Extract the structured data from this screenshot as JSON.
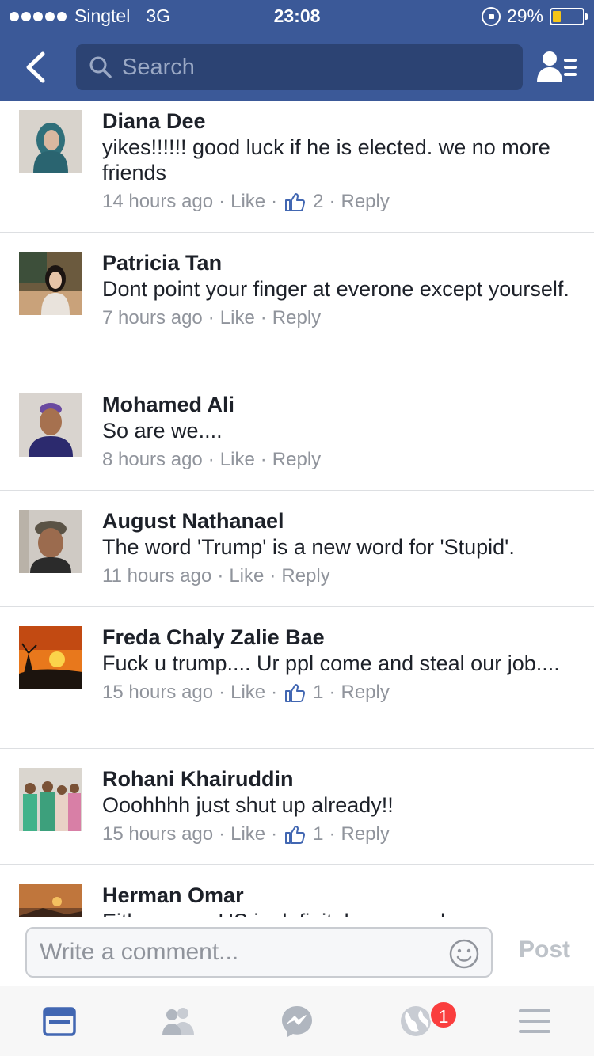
{
  "status_bar": {
    "carrier": "Singtel",
    "network": "3G",
    "time": "23:08",
    "battery": "29%",
    "battery_level": 0.29
  },
  "nav": {
    "search_placeholder": "Search"
  },
  "comments": [
    {
      "name": "Diana Dee",
      "text": "yikes!!!!!! good luck if he is elected. we no more friends",
      "time": "14 hours ago",
      "like": "Like",
      "likes": "2",
      "reply": "Reply"
    },
    {
      "name": "Patricia Tan",
      "text": "Dont point your finger at everone except yourself.",
      "time": "7 hours ago",
      "like": "Like",
      "likes": "",
      "reply": "Reply"
    },
    {
      "name": "Mohamed Ali",
      "text": "So are we....",
      "time": "8 hours ago",
      "like": "Like",
      "likes": "",
      "reply": "Reply"
    },
    {
      "name": "August Nathanael",
      "text": "The word 'Trump' is a new word for 'Stupid'.",
      "time": "11 hours ago",
      "like": "Like",
      "likes": "",
      "reply": "Reply"
    },
    {
      "name": "Freda Chaly Zalie Bae",
      "text": "Fuck u trump.... Ur ppl come and steal our job....",
      "time": "15 hours ago",
      "like": "Like",
      "likes": "1",
      "reply": "Reply"
    },
    {
      "name": "Rohani Khairuddin",
      "text": "Ooohhhh just shut up already!!",
      "time": "15 hours ago",
      "like": "Like",
      "likes": "1",
      "reply": "Reply"
    },
    {
      "name": "Herman Omar",
      "text": "Either way.. US is definitely screwed",
      "time": "",
      "like": "",
      "likes": "",
      "reply": ""
    }
  ],
  "composer": {
    "placeholder": "Write a comment...",
    "post_label": "Post"
  },
  "tabbar": {
    "tabs": [
      {
        "icon": "news-feed-icon",
        "active": true
      },
      {
        "icon": "friends-icon",
        "active": false
      },
      {
        "icon": "messenger-icon",
        "active": false
      },
      {
        "icon": "globe-icon",
        "active": false
      },
      {
        "icon": "menu-icon",
        "active": false
      }
    ],
    "notification_badge": "1"
  },
  "colors": {
    "brand": "#3b5998",
    "accent": "#4267b2",
    "badge": "#fa3e3e"
  }
}
